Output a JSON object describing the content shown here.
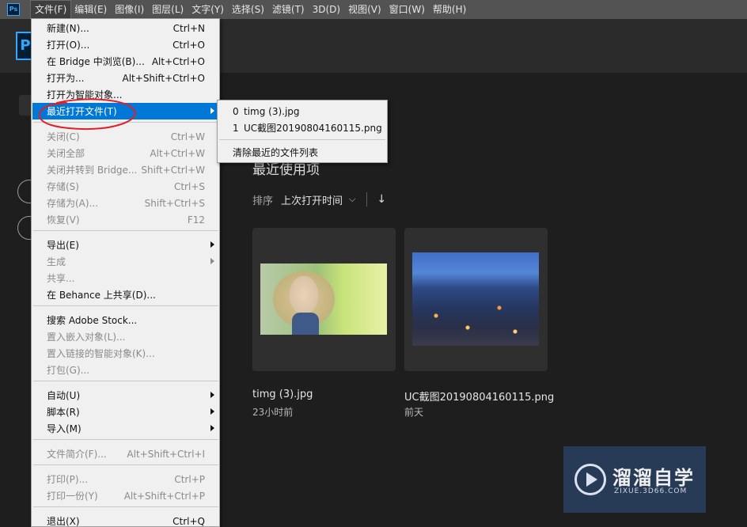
{
  "app": {
    "logo": "Ps",
    "home_logo": "P"
  },
  "menubar": {
    "items": [
      "文件(F)",
      "编辑(E)",
      "图像(I)",
      "图层(L)",
      "文字(Y)",
      "选择(S)",
      "滤镜(T)",
      "3D(D)",
      "视图(V)",
      "窗口(W)",
      "帮助(H)"
    ],
    "active": "文件(F)"
  },
  "file_menu": {
    "items": [
      {
        "label": "新建(N)...",
        "shortcut": "Ctrl+N",
        "enabled": true
      },
      {
        "label": "打开(O)...",
        "shortcut": "Ctrl+O",
        "enabled": true
      },
      {
        "label": "在 Bridge 中浏览(B)...",
        "shortcut": "Alt+Ctrl+O",
        "enabled": true
      },
      {
        "label": "打开为...",
        "shortcut": "Alt+Shift+Ctrl+O",
        "enabled": true
      },
      {
        "label": "打开为智能对象...",
        "shortcut": "",
        "enabled": true
      },
      {
        "label": "最近打开文件(T)",
        "shortcut": "",
        "enabled": true,
        "submenu": true,
        "highlighted": true
      },
      {
        "label": "关闭(C)",
        "shortcut": "Ctrl+W",
        "enabled": false
      },
      {
        "label": "关闭全部",
        "shortcut": "Alt+Ctrl+W",
        "enabled": false
      },
      {
        "label": "关闭并转到 Bridge...",
        "shortcut": "Shift+Ctrl+W",
        "enabled": false
      },
      {
        "label": "存储(S)",
        "shortcut": "Ctrl+S",
        "enabled": false
      },
      {
        "label": "存储为(A)...",
        "shortcut": "Shift+Ctrl+S",
        "enabled": false
      },
      {
        "label": "恢复(V)",
        "shortcut": "F12",
        "enabled": false
      },
      {
        "label": "导出(E)",
        "shortcut": "",
        "enabled": true,
        "submenu": true
      },
      {
        "label": "生成",
        "shortcut": "",
        "enabled": false,
        "submenu": true
      },
      {
        "label": "共享...",
        "shortcut": "",
        "enabled": false
      },
      {
        "label": "在 Behance 上共享(D)...",
        "shortcut": "",
        "enabled": true
      },
      {
        "label": "搜索 Adobe Stock...",
        "shortcut": "",
        "enabled": true
      },
      {
        "label": "置入嵌入对象(L)...",
        "shortcut": "",
        "enabled": false
      },
      {
        "label": "置入链接的智能对象(K)...",
        "shortcut": "",
        "enabled": false
      },
      {
        "label": "打包(G)...",
        "shortcut": "",
        "enabled": false
      },
      {
        "label": "自动(U)",
        "shortcut": "",
        "enabled": true,
        "submenu": true
      },
      {
        "label": "脚本(R)",
        "shortcut": "",
        "enabled": true,
        "submenu": true
      },
      {
        "label": "导入(M)",
        "shortcut": "",
        "enabled": true,
        "submenu": true
      },
      {
        "label": "文件简介(F)...",
        "shortcut": "Alt+Shift+Ctrl+I",
        "enabled": false
      },
      {
        "label": "打印(P)...",
        "shortcut": "Ctrl+P",
        "enabled": false
      },
      {
        "label": "打印一份(Y)",
        "shortcut": "Alt+Shift+Ctrl+P",
        "enabled": false
      },
      {
        "label": "退出(X)",
        "shortcut": "Ctrl+Q",
        "enabled": true
      }
    ]
  },
  "recent_submenu": {
    "files": [
      {
        "index": "0",
        "name": "timg (3).jpg"
      },
      {
        "index": "1",
        "name": "UC截图20190804160115.png"
      }
    ],
    "clear_label": "清除最近的文件列表"
  },
  "home": {
    "section_title": "最近使用项",
    "sort_label": "排序",
    "sort_value": "上次打开时间",
    "recent": [
      {
        "name": "timg (3).jpg",
        "time": "23小时前"
      },
      {
        "name": "UC截图20190804160115.png",
        "time": "前天"
      }
    ]
  },
  "watermark": {
    "title": "溜溜自学",
    "subtitle": "ZIXUE.3D66.COM"
  },
  "colors": {
    "highlight": "#0078d7",
    "annotation": "#e0202a",
    "ps_blue": "#31a8ff"
  }
}
